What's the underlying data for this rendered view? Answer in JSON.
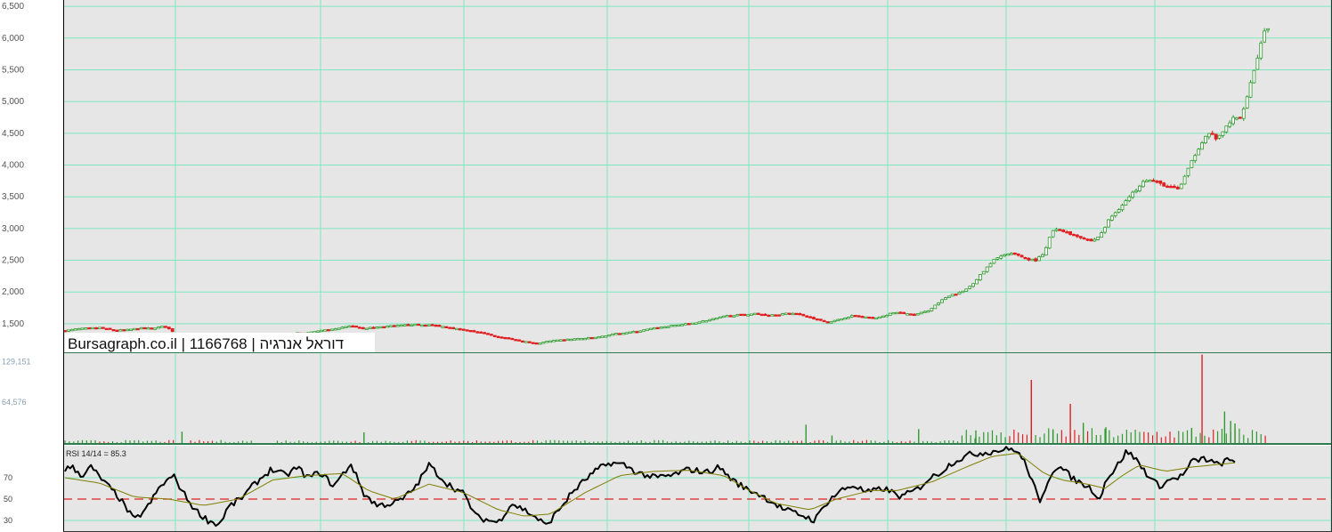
{
  "chart_data": [
    {
      "type": "candlestick",
      "panel": "price",
      "title": "Bursagraph.co.il | 1166768 | דוראל אנרגיה",
      "ylim": [
        1050,
        6600
      ],
      "yticks": [
        "6,500",
        "6,000",
        "5,500",
        "5,000",
        "4,500",
        "4,000",
        "3,500",
        "3,000",
        "2,500",
        "2,000",
        "1,500"
      ],
      "ytick_values": [
        6500,
        6000,
        5500,
        5000,
        4500,
        4000,
        3500,
        3000,
        2500,
        2000,
        1500
      ],
      "grid": true,
      "up_color": "#2e9a2e",
      "down_color": "#e02020",
      "close_anchors": [
        [
          0,
          1390
        ],
        [
          15,
          1420
        ],
        [
          40,
          1440
        ],
        [
          55,
          1400
        ],
        [
          70,
          1400
        ],
        [
          85,
          1430
        ],
        [
          100,
          1430
        ],
        [
          115,
          1460
        ],
        [
          130,
          1330
        ],
        [
          145,
          1320
        ],
        [
          160,
          1310
        ],
        [
          175,
          1300
        ],
        [
          190,
          1300
        ],
        [
          205,
          1310
        ],
        [
          220,
          1320
        ],
        [
          235,
          1330
        ],
        [
          250,
          1340
        ],
        [
          265,
          1350
        ],
        [
          280,
          1360
        ],
        [
          295,
          1390
        ],
        [
          310,
          1410
        ],
        [
          320,
          1440
        ],
        [
          330,
          1470
        ],
        [
          345,
          1430
        ],
        [
          355,
          1440
        ],
        [
          370,
          1460
        ],
        [
          385,
          1470
        ],
        [
          400,
          1490
        ],
        [
          410,
          1480
        ],
        [
          420,
          1480
        ],
        [
          430,
          1470
        ],
        [
          445,
          1440
        ],
        [
          460,
          1400
        ],
        [
          470,
          1380
        ],
        [
          480,
          1360
        ],
        [
          490,
          1320
        ],
        [
          500,
          1290
        ],
        [
          510,
          1280
        ],
        [
          520,
          1240
        ],
        [
          535,
          1210
        ],
        [
          545,
          1190
        ],
        [
          555,
          1220
        ],
        [
          570,
          1240
        ],
        [
          585,
          1260
        ],
        [
          600,
          1270
        ],
        [
          615,
          1290
        ],
        [
          630,
          1330
        ],
        [
          645,
          1360
        ],
        [
          660,
          1380
        ],
        [
          675,
          1420
        ],
        [
          690,
          1450
        ],
        [
          705,
          1480
        ],
        [
          720,
          1500
        ],
        [
          735,
          1540
        ],
        [
          750,
          1580
        ],
        [
          765,
          1630
        ],
        [
          780,
          1640
        ],
        [
          795,
          1660
        ],
        [
          810,
          1640
        ],
        [
          825,
          1650
        ],
        [
          840,
          1670
        ],
        [
          850,
          1640
        ],
        [
          860,
          1600
        ],
        [
          870,
          1560
        ],
        [
          880,
          1530
        ],
        [
          890,
          1550
        ],
        [
          900,
          1600
        ],
        [
          910,
          1630
        ],
        [
          920,
          1610
        ],
        [
          930,
          1590
        ],
        [
          940,
          1600
        ],
        [
          950,
          1650
        ],
        [
          960,
          1680
        ],
        [
          970,
          1660
        ],
        [
          980,
          1640
        ],
        [
          995,
          1700
        ],
        [
          1005,
          1800
        ],
        [
          1015,
          1900
        ],
        [
          1025,
          1960
        ],
        [
          1035,
          2000
        ],
        [
          1045,
          2100
        ],
        [
          1055,
          2250
        ],
        [
          1065,
          2400
        ],
        [
          1075,
          2550
        ],
        [
          1090,
          2600
        ],
        [
          1100,
          2580
        ],
        [
          1110,
          2520
        ],
        [
          1120,
          2500
        ],
        [
          1130,
          2600
        ],
        [
          1138,
          2950
        ],
        [
          1145,
          2980
        ],
        [
          1150,
          2980
        ],
        [
          1158,
          2920
        ],
        [
          1165,
          2900
        ],
        [
          1175,
          2850
        ],
        [
          1185,
          2800
        ],
        [
          1195,
          2900
        ],
        [
          1205,
          3150
        ],
        [
          1215,
          3300
        ],
        [
          1225,
          3450
        ],
        [
          1235,
          3600
        ],
        [
          1245,
          3780
        ],
        [
          1255,
          3750
        ],
        [
          1265,
          3700
        ],
        [
          1275,
          3650
        ],
        [
          1285,
          3620
        ],
        [
          1295,
          3900
        ],
        [
          1305,
          4200
        ],
        [
          1315,
          4450
        ],
        [
          1322,
          4500
        ],
        [
          1330,
          4400
        ],
        [
          1340,
          4600
        ],
        [
          1345,
          4700
        ],
        [
          1350,
          4750
        ],
        [
          1355,
          4700
        ],
        [
          1362,
          5000
        ],
        [
          1370,
          5400
        ],
        [
          1378,
          5800
        ],
        [
          1385,
          6200
        ],
        [
          1389,
          6100
        ]
      ],
      "gaps": [
        [
          128,
          144
        ],
        [
          218,
          242
        ]
      ]
    },
    {
      "type": "bar",
      "panel": "volume",
      "yticks": [
        "129,151",
        "64,576"
      ],
      "ytick_values": [
        129151,
        64576
      ],
      "ylim": [
        0,
        138000
      ],
      "spikes": [
        [
          135,
          18000
        ],
        [
          345,
          17000
        ],
        [
          855,
          29000
        ],
        [
          885,
          12000
        ],
        [
          985,
          22000
        ],
        [
          1051,
          20000
        ],
        [
          1115,
          100000
        ],
        [
          1140,
          20000
        ],
        [
          1160,
          62000
        ],
        [
          1175,
          32000
        ],
        [
          1201,
          25000
        ],
        [
          1300,
          24000
        ],
        [
          1312,
          140000
        ],
        [
          1338,
          50000
        ],
        [
          1345,
          35000
        ],
        [
          1350,
          31000
        ]
      ],
      "baseline_volume": 4000,
      "late_volume": 20000
    },
    {
      "type": "line",
      "panel": "rsi",
      "title": "RSI 14/14 = 85.3",
      "ylim": [
        20,
        100
      ],
      "yticks": [
        "70",
        "50",
        "30"
      ],
      "ytick_values": [
        70,
        50,
        30
      ],
      "reference_line": 50,
      "series": [
        {
          "role": "rsi",
          "color": "#000000",
          "anchors": [
            [
              0,
              78
            ],
            [
              8,
              80
            ],
            [
              20,
              72
            ],
            [
              30,
              80
            ],
            [
              45,
              66
            ],
            [
              62,
              52
            ],
            [
              80,
              30
            ],
            [
              95,
              42
            ],
            [
              110,
              62
            ],
            [
              125,
              72
            ],
            [
              138,
              54
            ],
            [
              150,
              40
            ],
            [
              165,
              30
            ],
            [
              178,
              26
            ],
            [
              188,
              42
            ],
            [
              205,
              52
            ],
            [
              220,
              65
            ],
            [
              238,
              78
            ],
            [
              255,
              72
            ],
            [
              268,
              80
            ],
            [
              280,
              70
            ],
            [
              295,
              75
            ],
            [
              310,
              62
            ],
            [
              330,
              83
            ],
            [
              345,
              55
            ],
            [
              360,
              44
            ],
            [
              378,
              46
            ],
            [
              390,
              50
            ],
            [
              405,
              62
            ],
            [
              420,
              82
            ],
            [
              440,
              65
            ],
            [
              460,
              55
            ],
            [
              475,
              33
            ],
            [
              490,
              30
            ],
            [
              500,
              28
            ],
            [
              515,
              46
            ],
            [
              530,
              40
            ],
            [
              545,
              32
            ],
            [
              555,
              25
            ],
            [
              570,
              40
            ],
            [
              585,
              56
            ],
            [
              600,
              68
            ],
            [
              615,
              78
            ],
            [
              630,
              84
            ],
            [
              645,
              82
            ],
            [
              660,
              75
            ],
            [
              680,
              70
            ],
            [
              700,
              72
            ],
            [
              720,
              78
            ],
            [
              740,
              75
            ],
            [
              755,
              80
            ],
            [
              770,
              68
            ],
            [
              785,
              60
            ],
            [
              800,
              55
            ],
            [
              815,
              48
            ],
            [
              830,
              40
            ],
            [
              850,
              35
            ],
            [
              865,
              30
            ],
            [
              880,
              48
            ],
            [
              895,
              58
            ],
            [
              910,
              63
            ],
            [
              925,
              56
            ],
            [
              945,
              60
            ],
            [
              965,
              52
            ],
            [
              985,
              60
            ],
            [
              995,
              68
            ],
            [
              1010,
              75
            ],
            [
              1025,
              85
            ],
            [
              1045,
              92
            ],
            [
              1065,
              94
            ],
            [
              1080,
              96
            ],
            [
              1095,
              97
            ],
            [
              1105,
              88
            ],
            [
              1115,
              70
            ],
            [
              1125,
              45
            ],
            [
              1135,
              70
            ],
            [
              1145,
              82
            ],
            [
              1155,
              75
            ],
            [
              1165,
              68
            ],
            [
              1180,
              62
            ],
            [
              1190,
              55
            ],
            [
              1195,
              48
            ],
            [
              1200,
              68
            ],
            [
              1210,
              76
            ],
            [
              1225,
              95
            ],
            [
              1235,
              88
            ],
            [
              1250,
              72
            ],
            [
              1262,
              62
            ],
            [
              1275,
              68
            ],
            [
              1290,
              72
            ],
            [
              1300,
              85
            ],
            [
              1315,
              88
            ],
            [
              1330,
              82
            ],
            [
              1340,
              86
            ],
            [
              1350,
              85
            ]
          ]
        },
        {
          "role": "signal",
          "color": "#7f7f00",
          "anchors": [
            [
              0,
              70
            ],
            [
              40,
              65
            ],
            [
              80,
              52
            ],
            [
              120,
              50
            ],
            [
              160,
              44
            ],
            [
              200,
              50
            ],
            [
              240,
              68
            ],
            [
              280,
              72
            ],
            [
              320,
              74
            ],
            [
              350,
              58
            ],
            [
              380,
              50
            ],
            [
              420,
              64
            ],
            [
              460,
              56
            ],
            [
              500,
              40
            ],
            [
              530,
              34
            ],
            [
              560,
              36
            ],
            [
              600,
              56
            ],
            [
              640,
              72
            ],
            [
              680,
              76
            ],
            [
              720,
              77
            ],
            [
              760,
              72
            ],
            [
              790,
              58
            ],
            [
              820,
              46
            ],
            [
              860,
              40
            ],
            [
              890,
              50
            ],
            [
              930,
              58
            ],
            [
              960,
              58
            ],
            [
              1000,
              66
            ],
            [
              1040,
              80
            ],
            [
              1070,
              90
            ],
            [
              1100,
              93
            ],
            [
              1130,
              74
            ],
            [
              1150,
              68
            ],
            [
              1180,
              64
            ],
            [
              1200,
              60
            ],
            [
              1220,
              72
            ],
            [
              1240,
              82
            ],
            [
              1270,
              76
            ],
            [
              1300,
              80
            ],
            [
              1350,
              84
            ]
          ]
        }
      ]
    }
  ]
}
